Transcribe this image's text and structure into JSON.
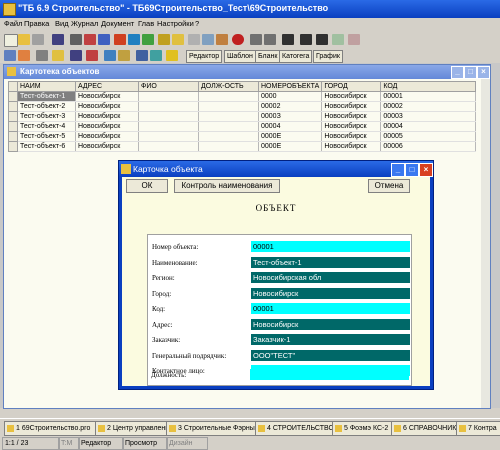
{
  "app": {
    "title": "\"ТБ 6.9 Строительство\" - ТБ69Строительство_Тест\\69Строительство",
    "colors": {
      "titlebar": "#0a3fc0",
      "accent_cyan": "#00ffff",
      "accent_teal": "#006868"
    }
  },
  "menu": [
    "Файл",
    "Правка",
    "Вид",
    "Журнал",
    "Документ",
    "Глав",
    "Настройки",
    "?"
  ],
  "toolbar": {
    "tabs": [
      "Редактор",
      "Шаблон",
      "Бланк",
      "Катогега",
      "График"
    ]
  },
  "child_window": {
    "title": "Картотека объектов",
    "columns": [
      "НАИМ",
      "АДРЕС",
      "ФИО",
      "ДОЛЖ-ОСТЬ",
      "НОМЕРОБЪЕКТА",
      "ГОРОД",
      "КОД"
    ],
    "rows": [
      [
        "Тест-объект-1",
        "Новосибирск",
        "",
        "",
        "0000",
        "Новосибирск",
        "00001"
      ],
      [
        "Тест-объект-2",
        "Новосибирск",
        "",
        "",
        "00002",
        "Новосибирск",
        "00002"
      ],
      [
        "Тест-объект-3",
        "Новосибирск",
        "",
        "",
        "0000З",
        "Новосибирск",
        "00003"
      ],
      [
        "Тест-объект-4",
        "Новосибирск",
        "",
        "",
        "00004",
        "Новосибирск",
        "00004"
      ],
      [
        "Тест-объект-5",
        "Новосибирск",
        "",
        "",
        "0000Е",
        "Новосибирск",
        "00005"
      ],
      [
        "Тест-объект-6",
        "Новосибирск",
        "",
        "",
        "0000Е",
        "Новосибирск",
        "00006"
      ]
    ]
  },
  "dialog": {
    "title": "Карточка объекта",
    "ok": "ОК",
    "check": "Контроль наименования",
    "cancel": "Отмена",
    "heading": "ОБЪЕКТ",
    "fields": [
      {
        "label": "Номер объекта:",
        "value": "00001",
        "style": "cyan"
      },
      {
        "label": "Наименование:",
        "value": "Тест-объект-1",
        "style": "teal"
      },
      {
        "label": "Регион:",
        "value": "Новосибирская обл",
        "style": "teal"
      },
      {
        "label": "Город:",
        "value": "Новосибирск",
        "style": "teal"
      },
      {
        "label": "Код:",
        "value": "00001",
        "style": "cyan"
      },
      {
        "label": "Адрес:",
        "value": "Новосибирск",
        "style": "teal"
      },
      {
        "label": "Заказчик:",
        "value": "Заказчик-1",
        "style": "teal"
      },
      {
        "label": "Генеральный подрядчик:",
        "value": "ООО\"ТЕСТ\"",
        "style": "teal"
      },
      {
        "label": "Контактное лицо:",
        "value": "",
        "style": "cyan"
      },
      {
        "label": "Должность:",
        "value": "",
        "style": "cyan"
      }
    ]
  },
  "task_tabs": [
    "1 69Строительство.pro",
    "2 Центр управления",
    "3 Строительные Фэрны",
    "4 СТРОИТЕЛЬСТВО",
    "5 Фоэмэ КС-2",
    "6 СПРАВОЧНИКИ",
    "7 Контра"
  ],
  "status": [
    "1:1 / 23",
    "T:M",
    "Редактор",
    "Просмотр",
    "Дизайн"
  ]
}
